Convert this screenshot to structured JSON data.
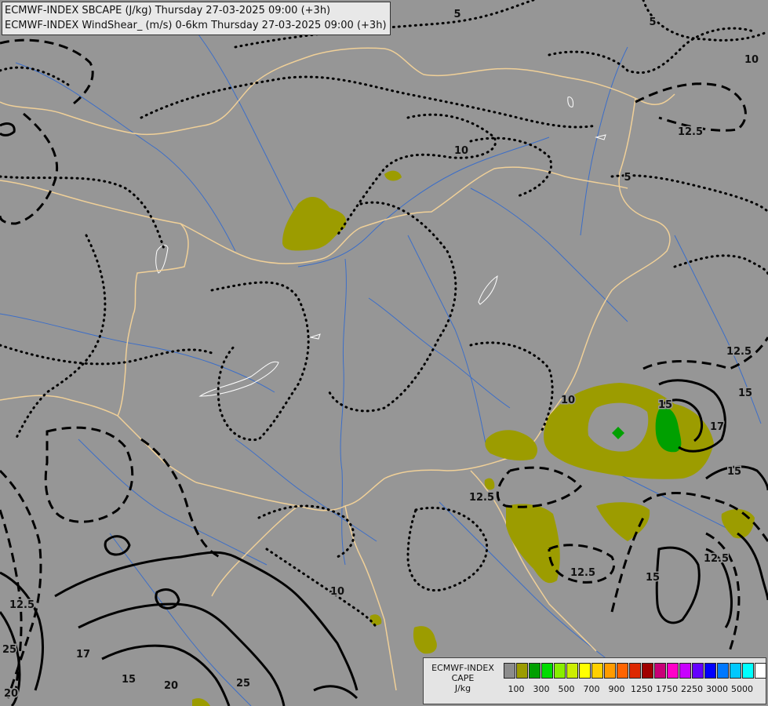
{
  "titles": {
    "line1": "ECMWF-INDEX SBCAPE (J/kg) Thursday 27-03-2025 09:00 (+3h)",
    "line2": "ECMWF-INDEX WindShear_ (m/s) 0-6km Thursday 27-03-2025 09:00 (+3h)"
  },
  "legend": {
    "line1": "ECMWF-INDEX",
    "line2": "CAPE",
    "line3": "J/kg",
    "colors": [
      "#8c8c8c",
      "#9c9c00",
      "#00a000",
      "#00dd00",
      "#88ee00",
      "#ccee00",
      "#ffff00",
      "#ffd000",
      "#ff9c00",
      "#ff6400",
      "#dd2800",
      "#a00000",
      "#c80078",
      "#ff00c8",
      "#c800ff",
      "#6400ff",
      "#0000ff",
      "#0078ff",
      "#00c8ff",
      "#00ffff",
      "#ffffff"
    ],
    "ticks": [
      "100",
      "300",
      "500",
      "700",
      "900",
      "1250",
      "1750",
      "2250",
      "3000",
      "5000"
    ]
  },
  "contour_labels": [
    {
      "text": "5"
    },
    {
      "text": "10"
    },
    {
      "text": "12.5"
    },
    {
      "text": "5"
    },
    {
      "text": "10"
    },
    {
      "text": "5"
    },
    {
      "text": "12.5"
    },
    {
      "text": "15"
    },
    {
      "text": "15"
    },
    {
      "text": "15"
    },
    {
      "text": "17"
    },
    {
      "text": "10"
    },
    {
      "text": "12.5"
    },
    {
      "text": "12.5"
    },
    {
      "text": "15"
    },
    {
      "text": "12.5"
    },
    {
      "text": "10"
    },
    {
      "text": "12.5"
    },
    {
      "text": "25"
    },
    {
      "text": "17"
    },
    {
      "text": "15"
    },
    {
      "text": "20"
    },
    {
      "text": "25"
    },
    {
      "text": "20"
    }
  ],
  "colors": {
    "background": "#969696",
    "border": "#f0d098",
    "river": "#3c6ec8",
    "contour": "#000000",
    "cape_low": "#9c9c00",
    "cape_mid": "#00a000",
    "lake": "#ffffff"
  }
}
